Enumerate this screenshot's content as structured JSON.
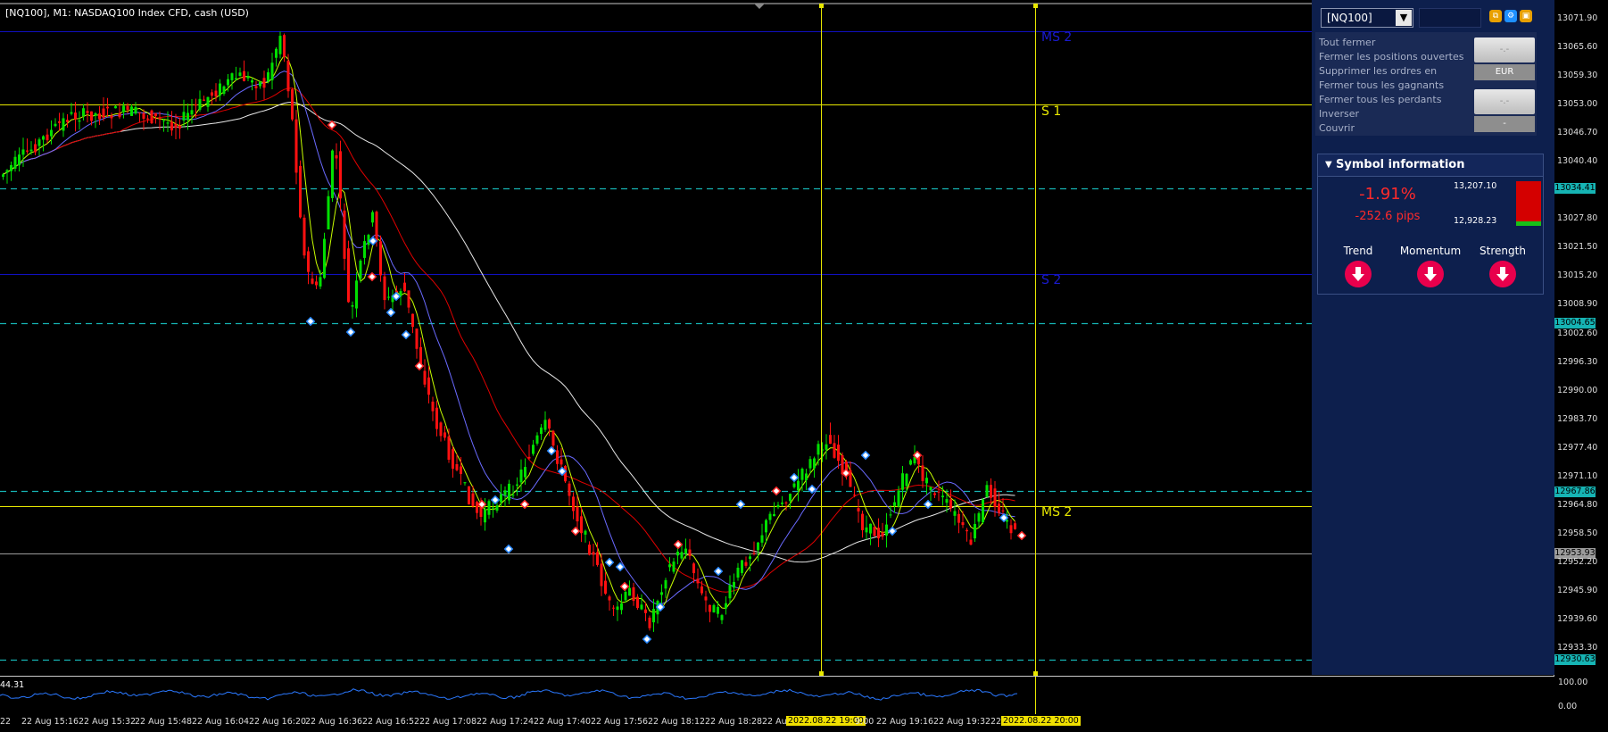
{
  "chart": {
    "title": "[NQ100], M1:  NASDAQ100 Index CFD, cash (USD)",
    "colors": {
      "background": "#000000",
      "bull": "#00e000",
      "bear": "#ff1010",
      "ma_red": "#e00000",
      "ma_blue": "#6a6aff",
      "ma_white": "#e8e8e8",
      "ma_yellow": "#c8ff00",
      "cyan_line": "#16b4b4",
      "yellow_line": "#e8e800",
      "navy_line": "#1010c0"
    },
    "level_labels": [
      "MS 2",
      "S 1",
      "S 2",
      "MS 2"
    ],
    "price_ticks": [
      "13071.90",
      "13065.60",
      "13059.30",
      "13053.00",
      "13046.70",
      "13040.40",
      "13027.80",
      "13021.50",
      "13015.20",
      "13008.90",
      "13002.60",
      "12996.30",
      "12990.00",
      "12983.70",
      "12977.40",
      "12971.10",
      "12964.80",
      "12958.50",
      "12952.20",
      "12945.90",
      "12939.60",
      "12933.30"
    ],
    "price_tags": [
      {
        "text": "13034.41",
        "color": "#16b4b4"
      },
      {
        "text": "13004.65",
        "color": "#16b4b4"
      },
      {
        "text": "12967.86",
        "color": "#16b4b4"
      },
      {
        "text": "12953.93",
        "color": "#9c9c9c"
      },
      {
        "text": "12930.63",
        "color": "#16b4b4"
      }
    ],
    "osc_value": "44.31",
    "osc_scale": [
      "100.00",
      "0.00"
    ],
    "time_labels": [
      "22",
      "22 Aug 15:16",
      "22 Aug 15:32",
      "22 Aug 15:48",
      "22 Aug 16:04",
      "22 Aug 16:20",
      "22 Aug 16:36",
      "22 Aug 16:52",
      "22 Aug 17:08",
      "22 Aug 17:24",
      "22 Aug 17:40",
      "22 Aug 17:56",
      "22 Aug 18:12",
      "22 Aug 18:28",
      "22 Au",
      "9:00",
      "22 Aug 19:16",
      "22 Aug 19:32",
      "22"
    ],
    "time_highlights": [
      "2022.08.22 19:00",
      "2022.08.22 20:00"
    ]
  },
  "panel": {
    "symbol": "[NQ100]",
    "toolbar_icons": [
      "copy-icon",
      "settings-icon",
      "window-icon"
    ],
    "commands": [
      "Tout fermer",
      "Fermer les positions ouvertes",
      "Supprimer les ordres en",
      "Fermer tous les gagnants",
      "Fermer tous les perdants",
      "Inverser",
      "Couvrir"
    ],
    "btn1_label": "-.-",
    "btn1_sub": "EUR",
    "btn2_label": "-.-",
    "btn2_sub": "-",
    "symbol_info": {
      "title": "Symbol information",
      "change_pct": "-1.91%",
      "change_pips": "-252.6 pips",
      "high": "13,207.10",
      "low": "12,928.23",
      "range_position": 0.1,
      "indicators": [
        {
          "label": "Trend",
          "direction": "down"
        },
        {
          "label": "Momentum",
          "direction": "down"
        },
        {
          "label": "Strength",
          "direction": "down"
        }
      ]
    }
  }
}
